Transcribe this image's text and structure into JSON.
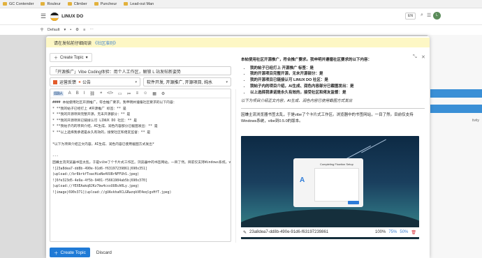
{
  "bookmarks": [
    {
      "label": "GC Contender"
    },
    {
      "label": "Rouleur"
    },
    {
      "label": "Climber"
    },
    {
      "label": "Puncheur"
    },
    {
      "label": "Lead-out Man"
    }
  ],
  "site": {
    "title": "LINUX DO",
    "lang": "EN",
    "avatar": "L"
  },
  "subbar": {
    "sort": "Default"
  },
  "notice": {
    "text": "请在发帖前仔细阅读",
    "link": "《社区准则》"
  },
  "composer": {
    "create_label": "Create Topic",
    "title_value": "「开源推广」Vibe Coding体验：用个人工作区，解锁 L 站发帖新姿势",
    "category": "运营反馈",
    "category_sub": "公告",
    "tags_placeholder": "软件开发, 开源推广, 开源项目, 纯水",
    "editor_text": "#### 本帖使用社区开源推广，符合推广要求。我申明并遵循社区要求的以下内容：\n* **我的帖子已经打上 #开源推广 标签：** 是\n* **我的开源项目完整开源，无未开源部分：** 是\n* **我的开源项目已链接认可 LINUX DO 社区：** 是\n* **我帖子内的项目介绍，AI生成、润色内容部分已截图发出：** 是\n* **以上选择我承诺是永久有效的，接受社区和佬友监督：** 是\n\n*以下为项目介绍正文内容，AI生成、润色内容已使用截图方式发出*\n\n---\n因嫌主流浏览器书签太乱，于是vibe了个卡片式工作区。浏览器中的书签网站，一目了然。目前仅支持Windows系统，vibe到0.5.0的版本。\n![23a8dea7-dd8b-490e-91d6-f63197239861|690x351]\n(upload://br8brkfToacHieNe4VU8rNFFUhS.jpeg)\n![6fe323d5-4e9a-4f5b-9401-f5661904ab5b|690x370]\n(upload://fEXEAakq8JKz7bw4cxxUU8cA0Ly.jpeg)\n![image|690x371](upload://gUAvkha0CLGRwzqkVE4eqlgvHfT.jpeg)",
    "primary_label": "Create Topic",
    "discard_label": "Discard"
  },
  "preview": {
    "intro": "本帖使用社区开源推广，符合推广要求。我申明并遵循社区要求的以下内容：",
    "items": [
      "我的帖子已经打上 开源推广 标签：是",
      "我的开源项目完整开源，无未开源部分：是",
      "我的开源项目已链接认可 LINUX DO 社区：是",
      "我帖子内的项目介绍，AI生成、润色内容部分已截图发出：是",
      "以上选择我承诺是永久有效的，接受社区和佬友监督：是"
    ],
    "italic": "以下为项目介绍正文内容，AI生成、润色内容已使用截图方式发出",
    "para": "因嫌主流浏览器书签太乱，于是vibe了个卡片式工作区。浏览器中的书签网站，一目了然。目前仅支持Windows系统，vibe到0.5.0的版本。",
    "dialog_title": "Completing Flowtion Setup",
    "dialog_letter": "A",
    "image_name": "23a8dea7-dd8b-490e-91d6-f63197239861",
    "zoom": [
      "100%",
      "75%",
      "50%"
    ]
  },
  "bg_right": {
    "label": "tivity"
  },
  "colors": {
    "accent": "#1f7ad6",
    "notice": "#fdf7c5",
    "category": "#e25b2b"
  },
  "icons": [
    "folder-icon",
    "menu-icon",
    "search-icon",
    "chat-icon",
    "chevron-down-icon",
    "trash-icon",
    "image-icon",
    "bold-icon"
  ]
}
